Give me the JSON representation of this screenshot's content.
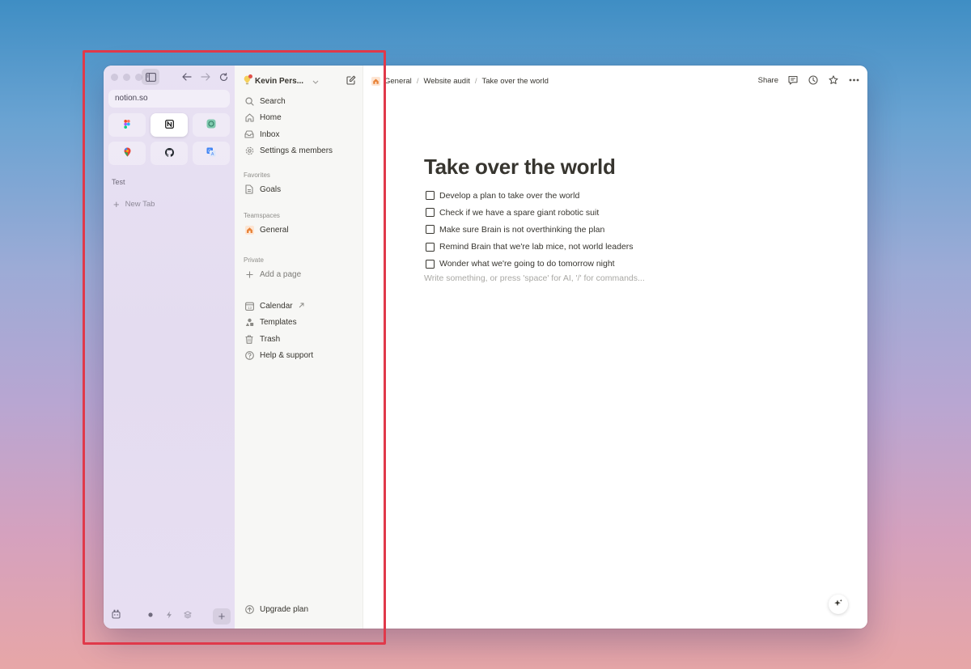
{
  "arc": {
    "url": "notion.so",
    "favorites": [
      {
        "name": "figma-icon",
        "color": "#f24e1e"
      },
      {
        "name": "notion-icon",
        "color": "#000000"
      },
      {
        "name": "chatgpt-icon",
        "color": "#10a37f"
      },
      {
        "name": "google-maps-icon",
        "color": "#34a853"
      },
      {
        "name": "github-icon",
        "color": "#24292f"
      },
      {
        "name": "google-translate-icon",
        "color": "#4285f4"
      }
    ],
    "section": "Test",
    "new_tab": "New Tab"
  },
  "sidebar": {
    "workspace": "Kevin Pers...",
    "nav": {
      "search": "Search",
      "home": "Home",
      "inbox": "Inbox",
      "settings": "Settings & members"
    },
    "favorites_label": "Favorites",
    "favorites": {
      "goals": "Goals"
    },
    "teamspaces_label": "Teamspaces",
    "teamspaces": {
      "general": "General"
    },
    "private_label": "Private",
    "add_page": "Add a page",
    "tools": {
      "calendar": "Calendar",
      "templates": "Templates",
      "trash": "Trash",
      "help": "Help & support"
    },
    "upgrade": "Upgrade plan"
  },
  "topbar": {
    "breadcrumb": [
      "General",
      "Website audit",
      "Take over the world"
    ],
    "share": "Share"
  },
  "page": {
    "title": "Take over the world",
    "todos": [
      "Develop a plan to take over the world",
      "Check if we have a spare giant robotic suit",
      "Make sure Brain is not overthinking the plan",
      "Remind Brain that we're lab mice, not world leaders",
      "Wonder what we're going to do tomorrow night"
    ],
    "placeholder": "Write something, or press 'space' for AI, '/' for commands..."
  },
  "colors": {
    "highlight": "#e0394a",
    "accent": "#37352f"
  }
}
